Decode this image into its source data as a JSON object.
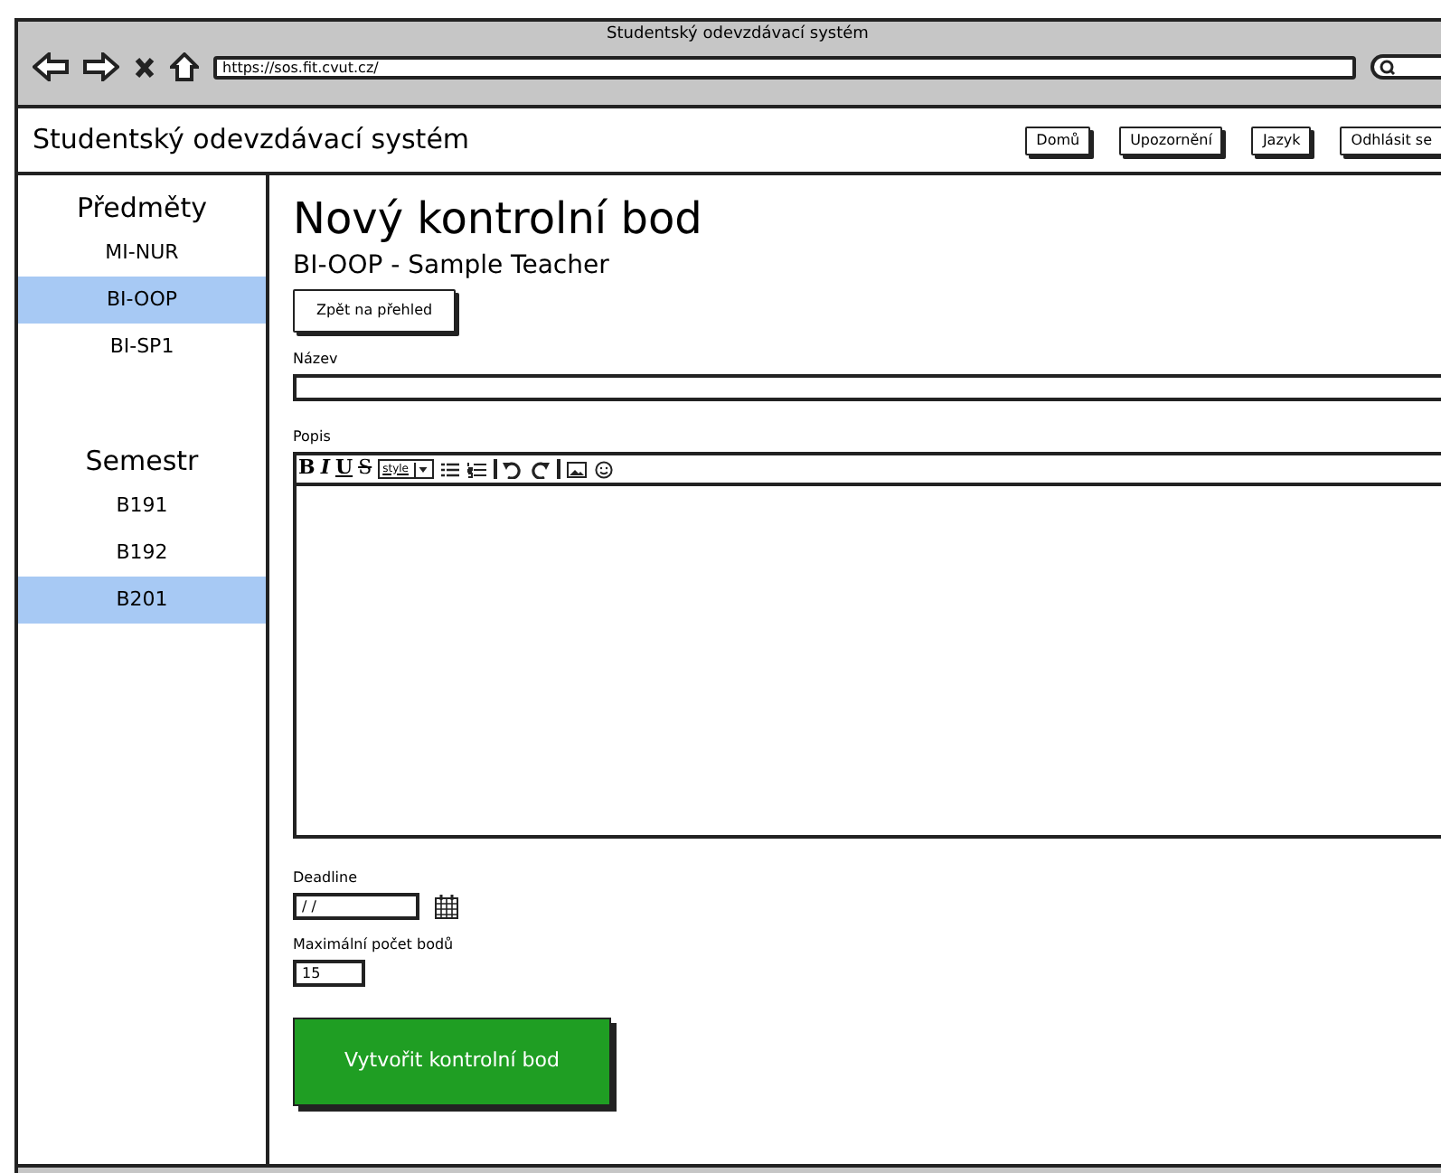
{
  "window": {
    "title": "Studentský odevzdávací systém",
    "url": "https://sos.fit.cvut.cz/"
  },
  "header": {
    "title": "Studentský odevzdávací systém",
    "buttons": [
      "Domů",
      "Upozornění",
      "Jazyk",
      "Odhlásit se"
    ]
  },
  "sidebar": {
    "sections": [
      {
        "heading": "Předměty",
        "items": [
          {
            "label": "MI-NUR",
            "selected": false
          },
          {
            "label": "BI-OOP",
            "selected": true
          },
          {
            "label": "BI-SP1",
            "selected": false
          }
        ]
      },
      {
        "heading": "Semestr",
        "items": [
          {
            "label": "B191",
            "selected": false
          },
          {
            "label": "B192",
            "selected": false
          },
          {
            "label": "B201",
            "selected": true
          }
        ]
      }
    ]
  },
  "main": {
    "title": "Nový kontrolní bod",
    "subtitle": "BI-OOP - Sample Teacher",
    "back_button": "Zpět na přehled",
    "name_field": {
      "label": "Název"
    },
    "description": {
      "label": "Popis",
      "toolbar": [
        {
          "kind": "bold",
          "label": "B"
        },
        {
          "kind": "italic",
          "label": "I"
        },
        {
          "kind": "underline",
          "label": "U"
        },
        {
          "kind": "strike",
          "label": "S"
        },
        {
          "kind": "select",
          "label": "style"
        },
        {
          "kind": "bullets"
        },
        {
          "kind": "numbers"
        },
        {
          "kind": "sep"
        },
        {
          "kind": "undo"
        },
        {
          "kind": "redo"
        },
        {
          "kind": "sep"
        },
        {
          "kind": "image"
        },
        {
          "kind": "emoji"
        }
      ]
    },
    "deadline": {
      "label": "Deadline",
      "value": "/ /"
    },
    "max_points": {
      "label": "Maximální počet bodů",
      "value": "15"
    },
    "submit_button": "Vytvořit kontrolní bod"
  }
}
